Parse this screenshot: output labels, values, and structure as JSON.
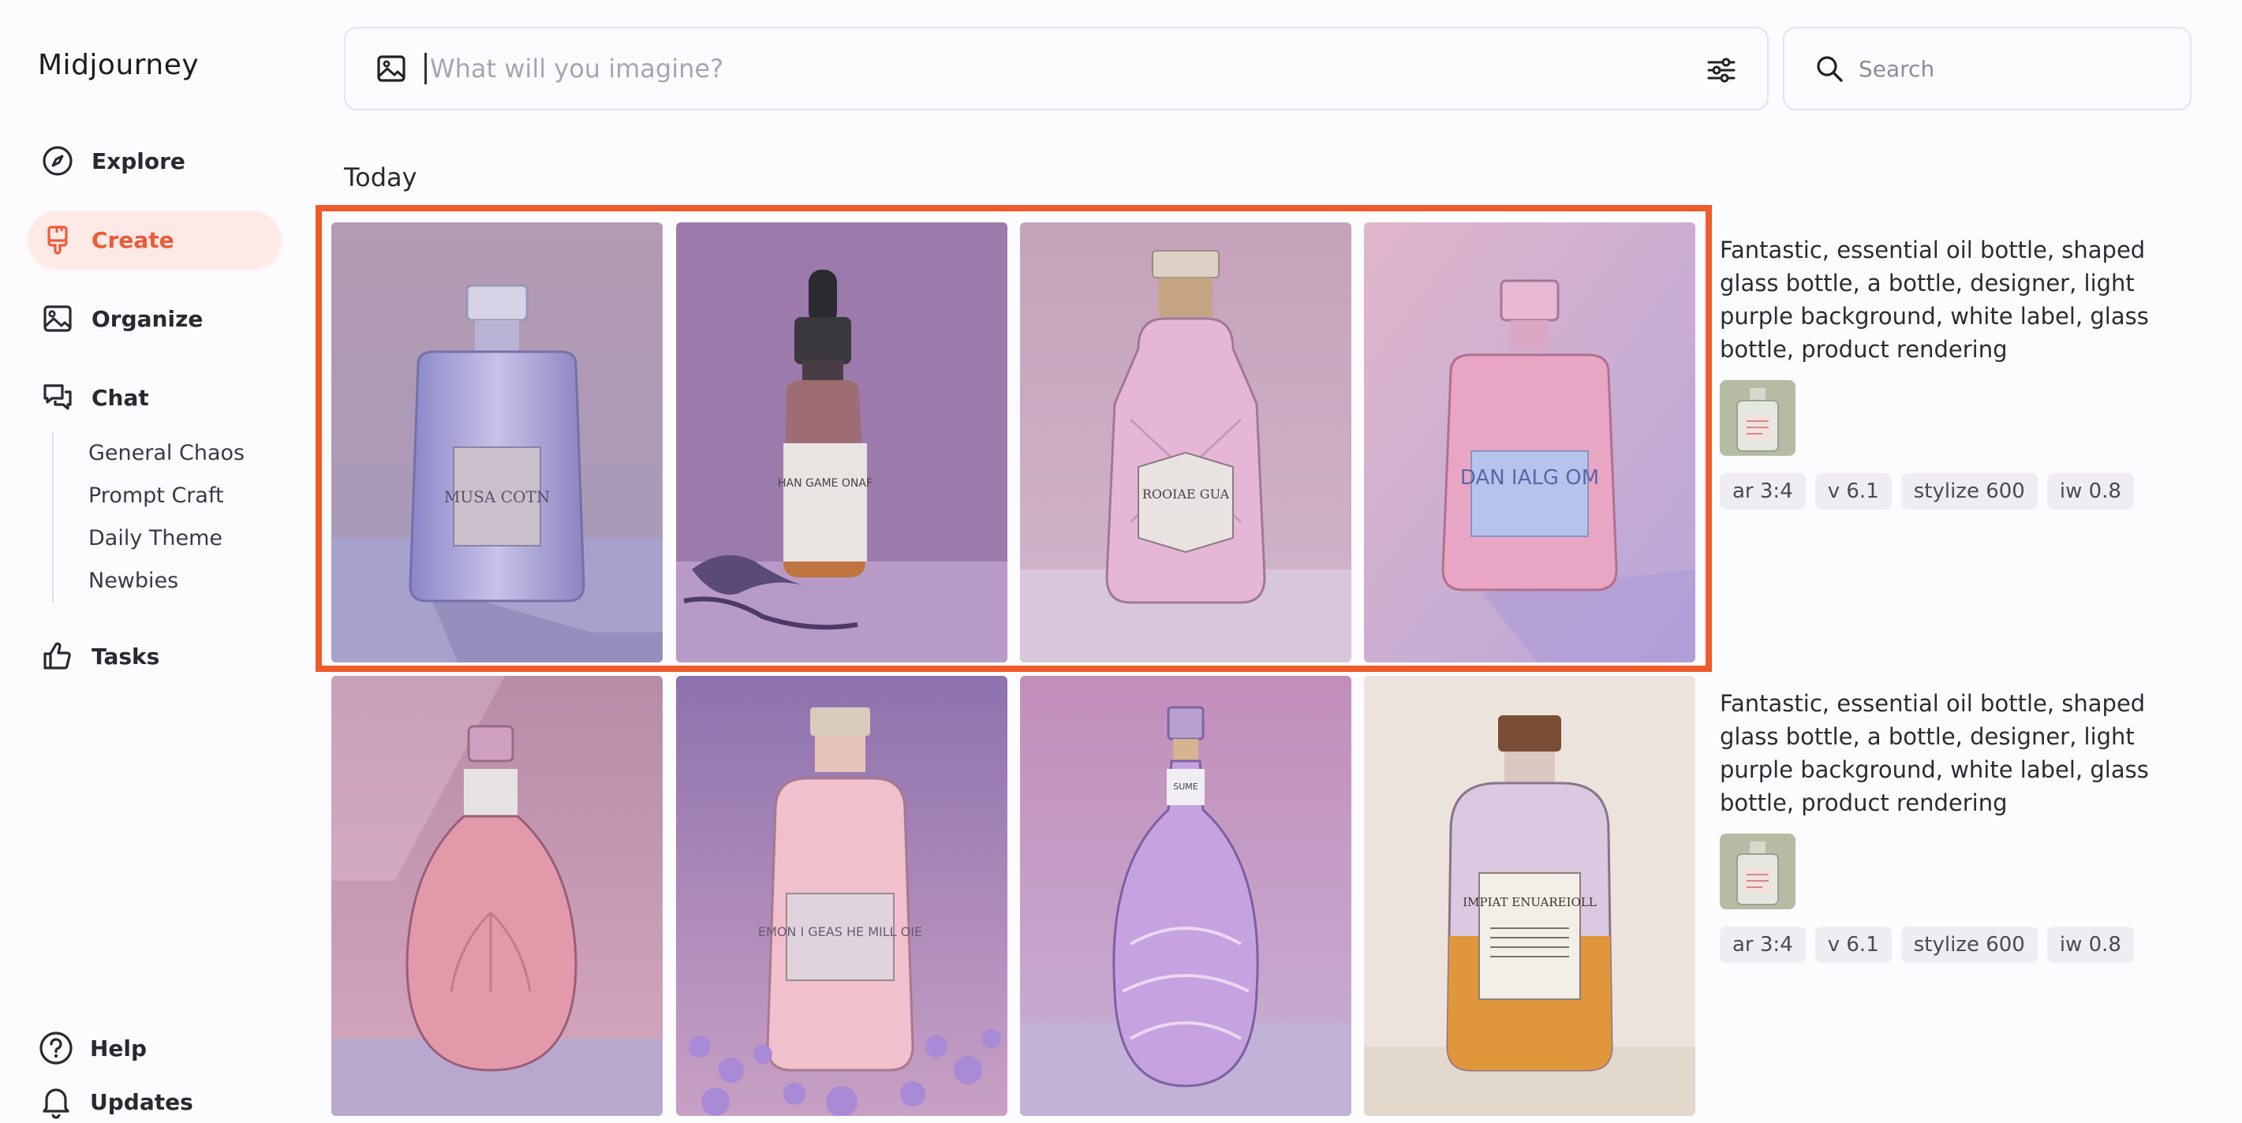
{
  "app": {
    "title": "Midjourney"
  },
  "sidebar": {
    "items": [
      {
        "label": "Explore",
        "icon": "compass-icon"
      },
      {
        "label": "Create",
        "icon": "paintbrush-icon",
        "active": true
      },
      {
        "label": "Organize",
        "icon": "image-icon"
      },
      {
        "label": "Chat",
        "icon": "chat-bubbles-icon"
      },
      {
        "label": "Tasks",
        "icon": "thumbs-up-icon"
      }
    ],
    "chat_channels": [
      "General Chaos",
      "Prompt Craft",
      "Daily Theme",
      "Newbies"
    ],
    "bottom": [
      {
        "label": "Help",
        "icon": "help-circle-icon"
      },
      {
        "label": "Updates",
        "icon": "bell-icon"
      }
    ]
  },
  "imagine": {
    "placeholder": "What will you imagine?"
  },
  "search": {
    "placeholder": "Search"
  },
  "section": {
    "title": "Today"
  },
  "jobs": [
    {
      "prompt": "Fantastic, essential oil bottle, shaped glass bottle, a bottle, designer, light purple background, white label, glass bottle, product rendering",
      "tags": [
        "ar 3:4",
        "v 6.1",
        "stylize 600",
        "iw 0.8"
      ],
      "images": [
        {
          "label_text": "MUSA COTN"
        },
        {
          "label_text": "HAN GAME ONAF"
        },
        {
          "label_text": "ROOIAE GUA"
        },
        {
          "label_text": "DAN IALG OM"
        }
      ]
    },
    {
      "prompt": "Fantastic, essential oil bottle, shaped glass bottle, a bottle, designer, light purple background, white label, glass bottle, product rendering",
      "tags": [
        "ar 3:4",
        "v 6.1",
        "stylize 600",
        "iw 0.8"
      ],
      "images": [
        {
          "label_text": ""
        },
        {
          "label_text": "EMON I GEAS HE MILL OIE"
        },
        {
          "label_text": "SUME"
        },
        {
          "label_text": "IMPIAT ENUAREIOLL"
        }
      ]
    }
  ],
  "colors": {
    "accent": "#ee5a36",
    "highlight": "#ef5a2a"
  }
}
